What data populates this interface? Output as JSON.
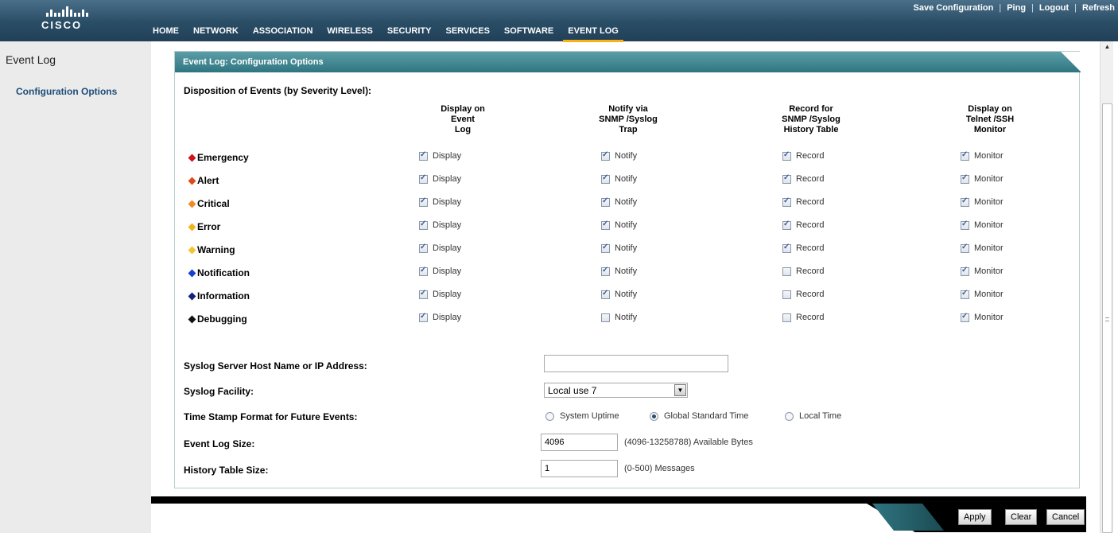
{
  "header": {
    "logo_text": "CISCO",
    "top_links": [
      "Save Configuration",
      "Ping",
      "Logout",
      "Refresh"
    ],
    "nav": [
      "HOME",
      "NETWORK",
      "ASSOCIATION",
      "WIRELESS",
      "SECURITY",
      "SERVICES",
      "SOFTWARE",
      "EVENT LOG"
    ],
    "active_nav": "EVENT LOG"
  },
  "sidebar": {
    "title": "Event Log",
    "item": "Configuration Options"
  },
  "panel": {
    "title": "Event Log: Configuration Options",
    "disposition_heading": "Disposition of Events (by Severity Level):",
    "columns": [
      [
        "Display on",
        "Event",
        "Log"
      ],
      [
        "Notify via",
        "SNMP /Syslog",
        "Trap"
      ],
      [
        "Record for",
        "SNMP /Syslog",
        "History Table"
      ],
      [
        "Display on",
        "Telnet /SSH",
        "Monitor"
      ]
    ],
    "checkbox_labels": [
      "Display",
      "Notify",
      "Record",
      "Monitor"
    ],
    "severities": [
      {
        "name": "Emergency",
        "color": "#d0121b",
        "checks": [
          true,
          true,
          true,
          true
        ]
      },
      {
        "name": "Alert",
        "color": "#e0491a",
        "checks": [
          true,
          true,
          true,
          true
        ]
      },
      {
        "name": "Critical",
        "color": "#f08a24",
        "checks": [
          true,
          true,
          true,
          true
        ]
      },
      {
        "name": "Error",
        "color": "#f6b21a",
        "checks": [
          true,
          true,
          true,
          true
        ]
      },
      {
        "name": "Warning",
        "color": "#f4c430",
        "checks": [
          true,
          true,
          true,
          true
        ]
      },
      {
        "name": "Notification",
        "color": "#1a3fd0",
        "checks": [
          true,
          true,
          false,
          true
        ]
      },
      {
        "name": "Information",
        "color": "#11237a",
        "checks": [
          true,
          true,
          false,
          true
        ]
      },
      {
        "name": "Debugging",
        "color": "#111111",
        "checks": [
          true,
          false,
          false,
          true
        ]
      }
    ],
    "syslog_host_label": "Syslog Server Host Name or IP Address:",
    "syslog_host_value": "",
    "facility_label": "Syslog Facility:",
    "facility_value": "Local use 7",
    "timestamp_label": "Time Stamp Format for Future Events:",
    "timestamp_options": [
      "System Uptime",
      "Global Standard Time",
      "Local Time"
    ],
    "timestamp_selected": "Global Standard Time",
    "log_size_label": "Event Log Size:",
    "log_size_value": "4096",
    "log_size_hint": "(4096-13258788) Available Bytes",
    "history_size_label": "History Table Size:",
    "history_size_value": "1",
    "history_size_hint": "(0-500) Messages"
  },
  "footer": {
    "buttons": [
      "Apply",
      "Clear",
      "Cancel"
    ]
  }
}
